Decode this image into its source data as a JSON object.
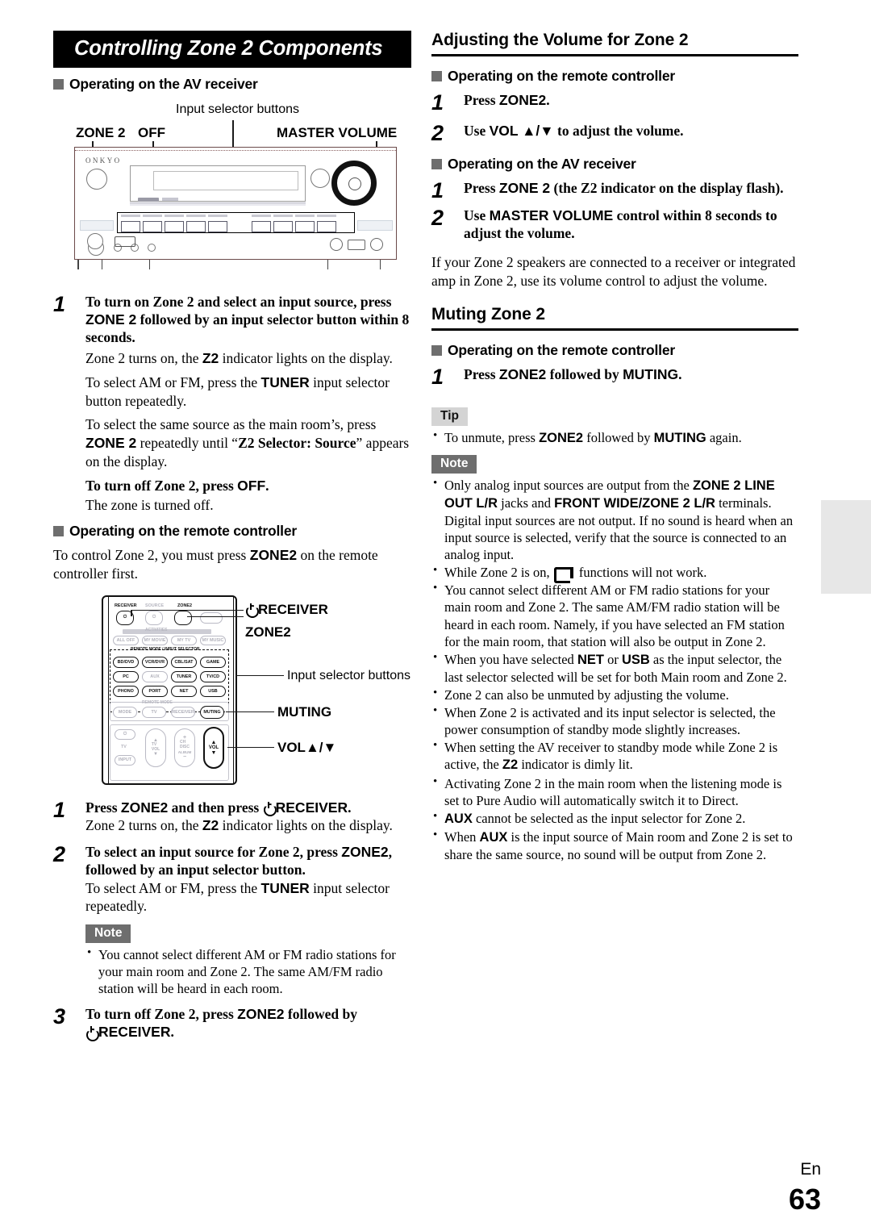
{
  "document": {
    "page_number": "63",
    "language_code": "En"
  },
  "left_column": {
    "banner_title": "Controlling Zone 2 Components",
    "section_av_receiver": {
      "heading": "Operating on the AV receiver",
      "figure": {
        "caption_input_selector": "Input selector buttons",
        "label_zone2": "ZONE 2",
        "label_off": "OFF",
        "label_master_volume": "MASTER VOLUME",
        "brand": "ONKYO"
      },
      "steps": [
        {
          "num": "1",
          "title_parts": [
            {
              "t": "To turn on Zone 2 and select an input source, press ",
              "style": "bold-serif"
            },
            {
              "t": "ZONE 2",
              "style": "bold-sans"
            },
            {
              "t": " followed by an input selector button within 8 seconds.",
              "style": "bold-serif"
            }
          ]
        }
      ],
      "paragraphs": [
        [
          {
            "t": "Zone 2 turns on, the ",
            "style": "normal"
          },
          {
            "t": "Z2",
            "style": "bold-sans"
          },
          {
            "t": " indicator lights on the display.",
            "style": "normal"
          }
        ],
        [
          {
            "t": "To select AM or FM, press the ",
            "style": "normal"
          },
          {
            "t": "TUNER",
            "style": "bold-sans"
          },
          {
            "t": " input selector button repeatedly.",
            "style": "normal"
          }
        ],
        [
          {
            "t": "To select the same source as the main room’s, press ",
            "style": "normal"
          },
          {
            "t": "ZONE 2",
            "style": "bold-sans"
          },
          {
            "t": " repeatedly until “",
            "style": "normal"
          },
          {
            "t": "Z2 Selector: Source",
            "style": "bold-serif"
          },
          {
            "t": "” appears on the display.",
            "style": "normal"
          }
        ]
      ],
      "turn_off_heading": [
        {
          "t": "To turn off Zone 2, press ",
          "style": "bold-serif"
        },
        {
          "t": "OFF",
          "style": "bold-sans"
        },
        {
          "t": ".",
          "style": "bold-serif"
        }
      ],
      "turn_off_body": "The zone is turned off."
    },
    "section_remote": {
      "heading": "Operating on the remote controller",
      "intro": [
        {
          "t": "To control Zone 2, you must press ",
          "style": "normal"
        },
        {
          "t": "ZONE2",
          "style": "bold-sans"
        },
        {
          "t": " on the remote controller first.",
          "style": "normal"
        }
      ],
      "figure": {
        "callout_receiver": "RECEIVER",
        "callout_zone2": "ZONE2",
        "callout_input_selector": "Input selector buttons",
        "callout_muting": "MUTING",
        "callout_vol": "VOL▲/▼",
        "group_label_activities": "ACTIVITIES",
        "group_label_remote_input": "REMOTE MODE / INPUT SELECTOR",
        "group_label_remote_mode": "REMOTE MODE",
        "top_labels": [
          "RECEIVER",
          "SOURCE",
          "ZONE2"
        ],
        "activity_buttons": [
          "ALL OFF",
          "MY MOVIE",
          "MY TV",
          "MY MUSIC"
        ],
        "input_buttons": [
          "BD/DVD",
          "VCR/DVR",
          "CBL/SAT",
          "GAME",
          "PC",
          "AUX",
          "TUNER",
          "TV/CD",
          "PHONO",
          "PORT",
          "NET",
          "USB"
        ],
        "mode_buttons": [
          "MODE",
          "TV",
          "RECEIVER"
        ],
        "muting_button": "MUTING",
        "bottom_labels": [
          "TV",
          "INPUT",
          "TV VOL",
          "CH DISC",
          "ALBUM",
          "VOL"
        ]
      },
      "steps": [
        {
          "num": "1",
          "title_parts": [
            {
              "t": "Press ",
              "style": "bold-serif"
            },
            {
              "t": "ZONE2",
              "style": "bold-sans"
            },
            {
              "t": " and then press ",
              "style": "bold-serif"
            },
            {
              "t": "power",
              "style": "icon-power"
            },
            {
              "t": "RECEIVER",
              "style": "bold-sans"
            },
            {
              "t": ".",
              "style": "bold-serif"
            }
          ],
          "body": [
            {
              "t": "Zone 2 turns on, the ",
              "style": "normal"
            },
            {
              "t": "Z2",
              "style": "bold-sans"
            },
            {
              "t": " indicator lights on the display.",
              "style": "normal"
            }
          ]
        },
        {
          "num": "2",
          "title_parts": [
            {
              "t": "To select an input source for Zone 2, press ",
              "style": "bold-serif"
            },
            {
              "t": "ZONE2",
              "style": "bold-sans"
            },
            {
              "t": ", followed by an input selector button.",
              "style": "bold-serif"
            }
          ],
          "body": [
            {
              "t": "To select AM or FM, press the ",
              "style": "normal"
            },
            {
              "t": "TUNER",
              "style": "bold-sans"
            },
            {
              "t": " input selector repeatedly.",
              "style": "normal"
            }
          ]
        },
        {
          "num": "3",
          "title_parts": [
            {
              "t": "To turn off Zone 2, press ",
              "style": "bold-serif"
            },
            {
              "t": "ZONE2",
              "style": "bold-sans"
            },
            {
              "t": " followed by ",
              "style": "bold-serif"
            },
            {
              "t": "power",
              "style": "icon-power"
            },
            {
              "t": "RECEIVER",
              "style": "bold-sans"
            },
            {
              "t": ".",
              "style": "bold-serif"
            }
          ]
        }
      ],
      "note": {
        "tag": "Note",
        "items": [
          [
            {
              "t": "You cannot select different AM or FM radio stations for your main room and Zone 2. The same AM/FM radio station will be heard in each room.",
              "style": "normal"
            }
          ]
        ]
      }
    }
  },
  "right_column": {
    "section_volume": {
      "heading": "Adjusting the Volume for Zone 2",
      "sub_remote": "Operating on the remote controller",
      "steps_remote": [
        {
          "num": "1",
          "parts": [
            {
              "t": "Press ",
              "style": "bold-serif"
            },
            {
              "t": "ZONE2",
              "style": "bold-sans"
            },
            {
              "t": ".",
              "style": "bold-serif"
            }
          ]
        },
        {
          "num": "2",
          "parts": [
            {
              "t": "Use ",
              "style": "bold-serif"
            },
            {
              "t": "VOL ▲/▼",
              "style": "bold-sans"
            },
            {
              "t": " to adjust the volume.",
              "style": "bold-serif"
            }
          ]
        }
      ],
      "sub_receiver": "Operating on the AV receiver",
      "steps_receiver": [
        {
          "num": "1",
          "parts": [
            {
              "t": "Press ",
              "style": "bold-serif"
            },
            {
              "t": "ZONE 2",
              "style": "bold-sans"
            },
            {
              "t": " (the Z2 indicator on the display flash).",
              "style": "bold-serif"
            }
          ]
        },
        {
          "num": "2",
          "parts": [
            {
              "t": "Use ",
              "style": "bold-serif"
            },
            {
              "t": "MASTER VOLUME",
              "style": "bold-sans"
            },
            {
              "t": " control within 8 seconds to adjust the volume.",
              "style": "bold-serif"
            }
          ]
        }
      ],
      "closing_paragraph": "If your Zone 2 speakers are connected to a receiver or integrated amp in Zone 2, use its volume control to adjust the volume."
    },
    "section_muting": {
      "heading": "Muting Zone 2",
      "sub_remote": "Operating on the remote controller",
      "steps": [
        {
          "num": "1",
          "parts": [
            {
              "t": "Press ",
              "style": "bold-serif"
            },
            {
              "t": "ZONE2",
              "style": "bold-sans"
            },
            {
              "t": " followed by ",
              "style": "bold-serif"
            },
            {
              "t": "MUTING",
              "style": "bold-sans"
            },
            {
              "t": ".",
              "style": "bold-serif"
            }
          ]
        }
      ],
      "tip": {
        "tag": "Tip",
        "items": [
          [
            {
              "t": "To unmute, press ",
              "style": "normal"
            },
            {
              "t": "ZONE2",
              "style": "bold-sans"
            },
            {
              "t": " followed by ",
              "style": "normal"
            },
            {
              "t": "MUTING",
              "style": "bold-sans"
            },
            {
              "t": " again.",
              "style": "normal"
            }
          ]
        ]
      },
      "note": {
        "tag": "Note",
        "items": [
          [
            {
              "t": "Only analog input sources are output from the ",
              "style": "normal"
            },
            {
              "t": "ZONE 2 LINE OUT L/R",
              "style": "bold-sans"
            },
            {
              "t": " jacks and ",
              "style": "normal"
            },
            {
              "t": "FRONT WIDE/ZONE 2 L/R",
              "style": "bold-sans"
            },
            {
              "t": " terminals. Digital input sources are not output. If no sound is heard when an input source is selected, verify that the source is connected to an analog input.",
              "style": "normal"
            }
          ],
          [
            {
              "t": "While Zone 2 is on, ",
              "style": "normal"
            },
            {
              "t": "RI",
              "style": "icon-ri"
            },
            {
              "t": " functions will not work.",
              "style": "normal"
            }
          ],
          [
            {
              "t": "You cannot select different AM or FM radio stations for your main room and Zone 2. The same AM/FM radio station will be heard in each room. Namely, if you have selected an FM station for the main room, that station will also be output in Zone 2.",
              "style": "normal"
            }
          ],
          [
            {
              "t": "When you have selected ",
              "style": "normal"
            },
            {
              "t": "NET",
              "style": "bold-sans"
            },
            {
              "t": " or ",
              "style": "normal"
            },
            {
              "t": "USB",
              "style": "bold-sans"
            },
            {
              "t": " as the input selector, the last selector selected will be set for both Main room and Zone 2.",
              "style": "normal"
            }
          ],
          [
            {
              "t": "Zone 2 can also be unmuted by adjusting the volume.",
              "style": "normal"
            }
          ],
          [
            {
              "t": "When Zone 2 is activated and its input selector is selected, the power consumption of standby mode slightly increases.",
              "style": "normal"
            }
          ],
          [
            {
              "t": "When setting the AV receiver to standby mode while Zone 2 is active, the ",
              "style": "normal"
            },
            {
              "t": "Z2",
              "style": "bold-sans"
            },
            {
              "t": " indicator is dimly lit.",
              "style": "normal"
            }
          ],
          [
            {
              "t": "Activating Zone 2 in the main room when the listening mode is set to Pure Audio will automatically switch it to Direct.",
              "style": "normal"
            }
          ],
          [
            {
              "t": "AUX",
              "style": "bold-sans"
            },
            {
              "t": " cannot be selected as the input selector for Zone 2.",
              "style": "normal"
            }
          ],
          [
            {
              "t": "When ",
              "style": "normal"
            },
            {
              "t": "AUX",
              "style": "bold-sans"
            },
            {
              "t": " is the input source of Main room and Zone 2 is set to share the same source, no sound will be output from Zone 2.",
              "style": "normal"
            }
          ]
        ]
      }
    }
  }
}
